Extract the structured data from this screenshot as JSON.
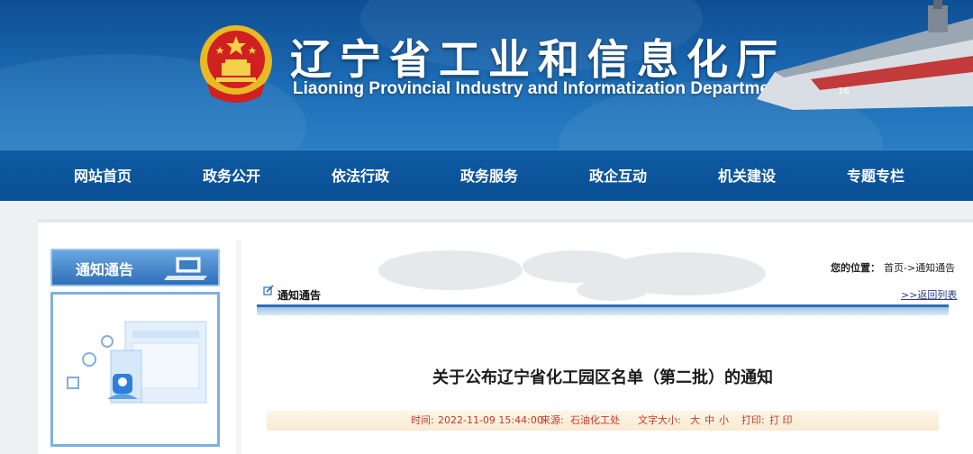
{
  "header": {
    "title_cn": "辽宁省工业和信息化厅",
    "title_en": "Liaoning Provincial Industry and Informatization Department"
  },
  "nav": {
    "items": [
      "网站首页",
      "政务公开",
      "依法行政",
      "政务服务",
      "政企互动",
      "机关建设",
      "专题专栏"
    ]
  },
  "sidebar": {
    "heading": "通知通告"
  },
  "location": {
    "label": "您的位置：",
    "home": "首页",
    "separator": "->",
    "current": "通知通告"
  },
  "section": {
    "title": "通知通告",
    "back_link": ">>返回列表"
  },
  "article": {
    "title": "关于公布辽宁省化工园区名单（第二批）的通知",
    "meta": {
      "time_label": "时间:",
      "time_value": "2022-11-09 15:44:00",
      "source_label": "来源:",
      "source_value": "石油化工处",
      "font_size_label": "文字大小:",
      "font_sizes": [
        "大",
        "中",
        "小"
      ],
      "print_label": "打印:",
      "print_value": "打 印"
    }
  },
  "colors": {
    "nav_bg": "#0a4f95",
    "accent_blue": "#2d6db5",
    "meta_red": "#c0392b"
  }
}
